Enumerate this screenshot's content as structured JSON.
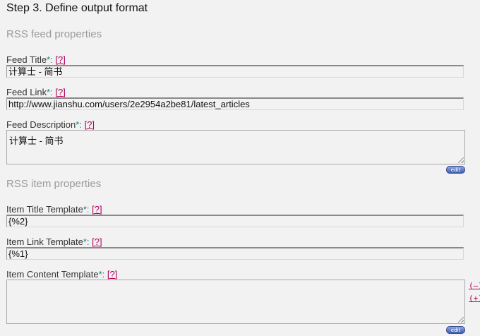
{
  "step_title": "Step 3. Define output format",
  "feed_section": {
    "title": "RSS feed properties",
    "title_field": {
      "label": "Feed Title",
      "required": "*:",
      "help": "[?]",
      "value": "计算士 - 简书"
    },
    "link_field": {
      "label": "Feed Link",
      "required": "*:",
      "help": "[?]",
      "value": "http://www.jianshu.com/users/2e2954a2be81/latest_articles"
    },
    "description_field": {
      "label": "Feed Description",
      "required": "*:",
      "help": "[?]",
      "value": "计算士 - 简书"
    },
    "edit_label": "edit"
  },
  "item_section": {
    "title": "RSS item properties",
    "title_template": {
      "label": "Item Title Template",
      "required": "*:",
      "help": "[?]",
      "value": "{%2}"
    },
    "link_template": {
      "label": "Item Link Template",
      "required": "*:",
      "help": "[?]",
      "value": "{%1}"
    },
    "content_template": {
      "label": "Item Content Template",
      "required": "*:",
      "help": "[?]",
      "value": ""
    },
    "shrink_label": "(–)",
    "grow_label": "(+)",
    "edit_label": "edit"
  }
}
